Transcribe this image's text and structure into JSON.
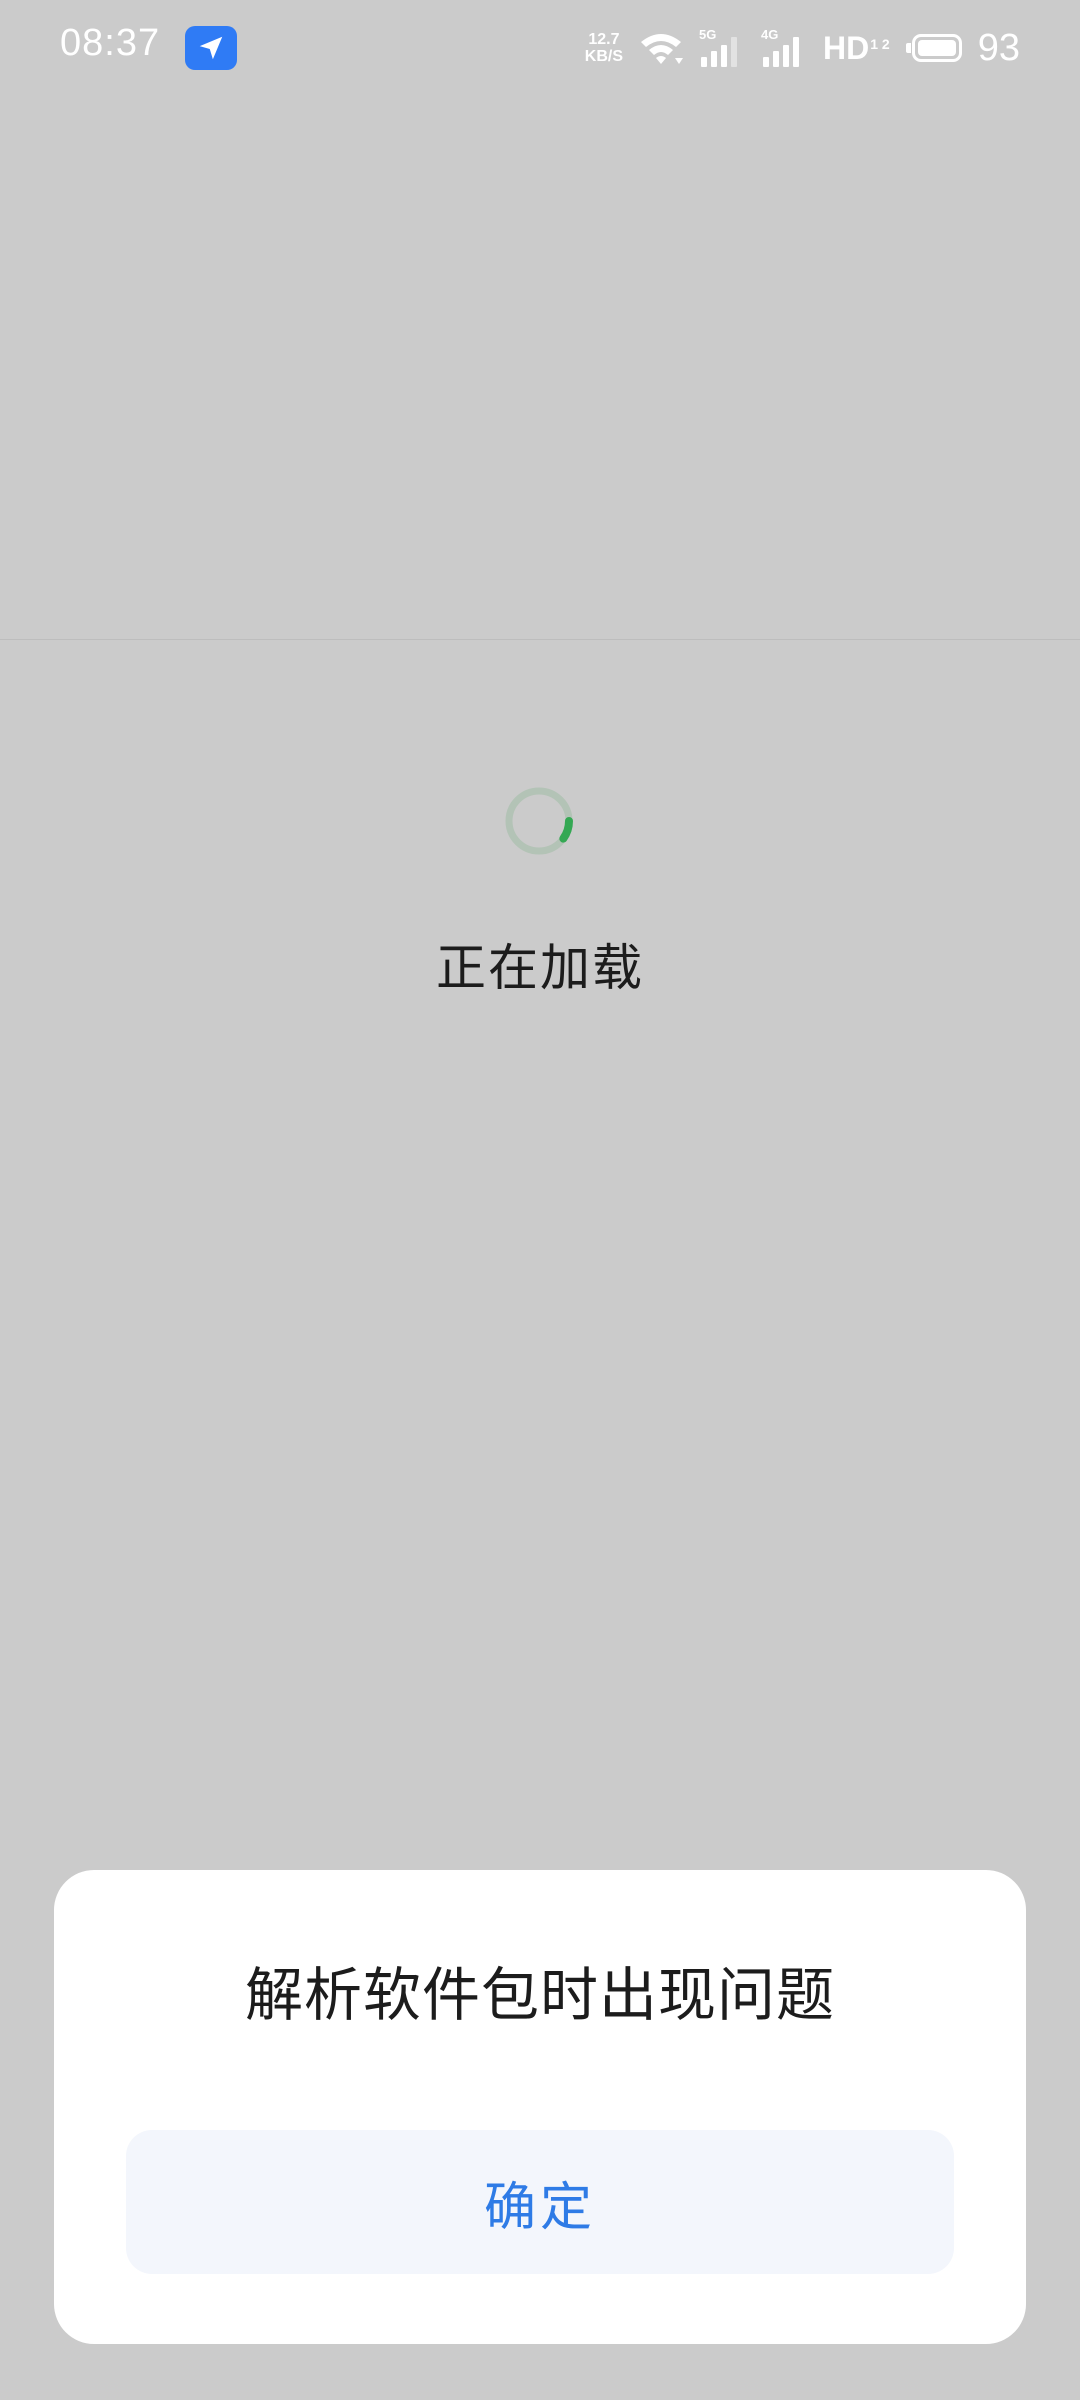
{
  "status_bar": {
    "time": "08:37",
    "nav_app_icon": "navigation-arrow-icon",
    "net_speed_value": "12.7",
    "net_speed_unit": "KB/S",
    "sim1_type": "5G",
    "sim2_type": "4G",
    "hd_label": "HD",
    "hd_sub": "1 2",
    "battery_level": "93"
  },
  "loading": {
    "text": "正在加载",
    "spinner_color": "#34a853"
  },
  "dialog": {
    "title": "解析软件包时出现问题",
    "confirm_label": "确定"
  },
  "colors": {
    "background": "#cbcbcb",
    "accent": "#2e7be6",
    "nav_icon_bg": "#2f7bf5"
  }
}
